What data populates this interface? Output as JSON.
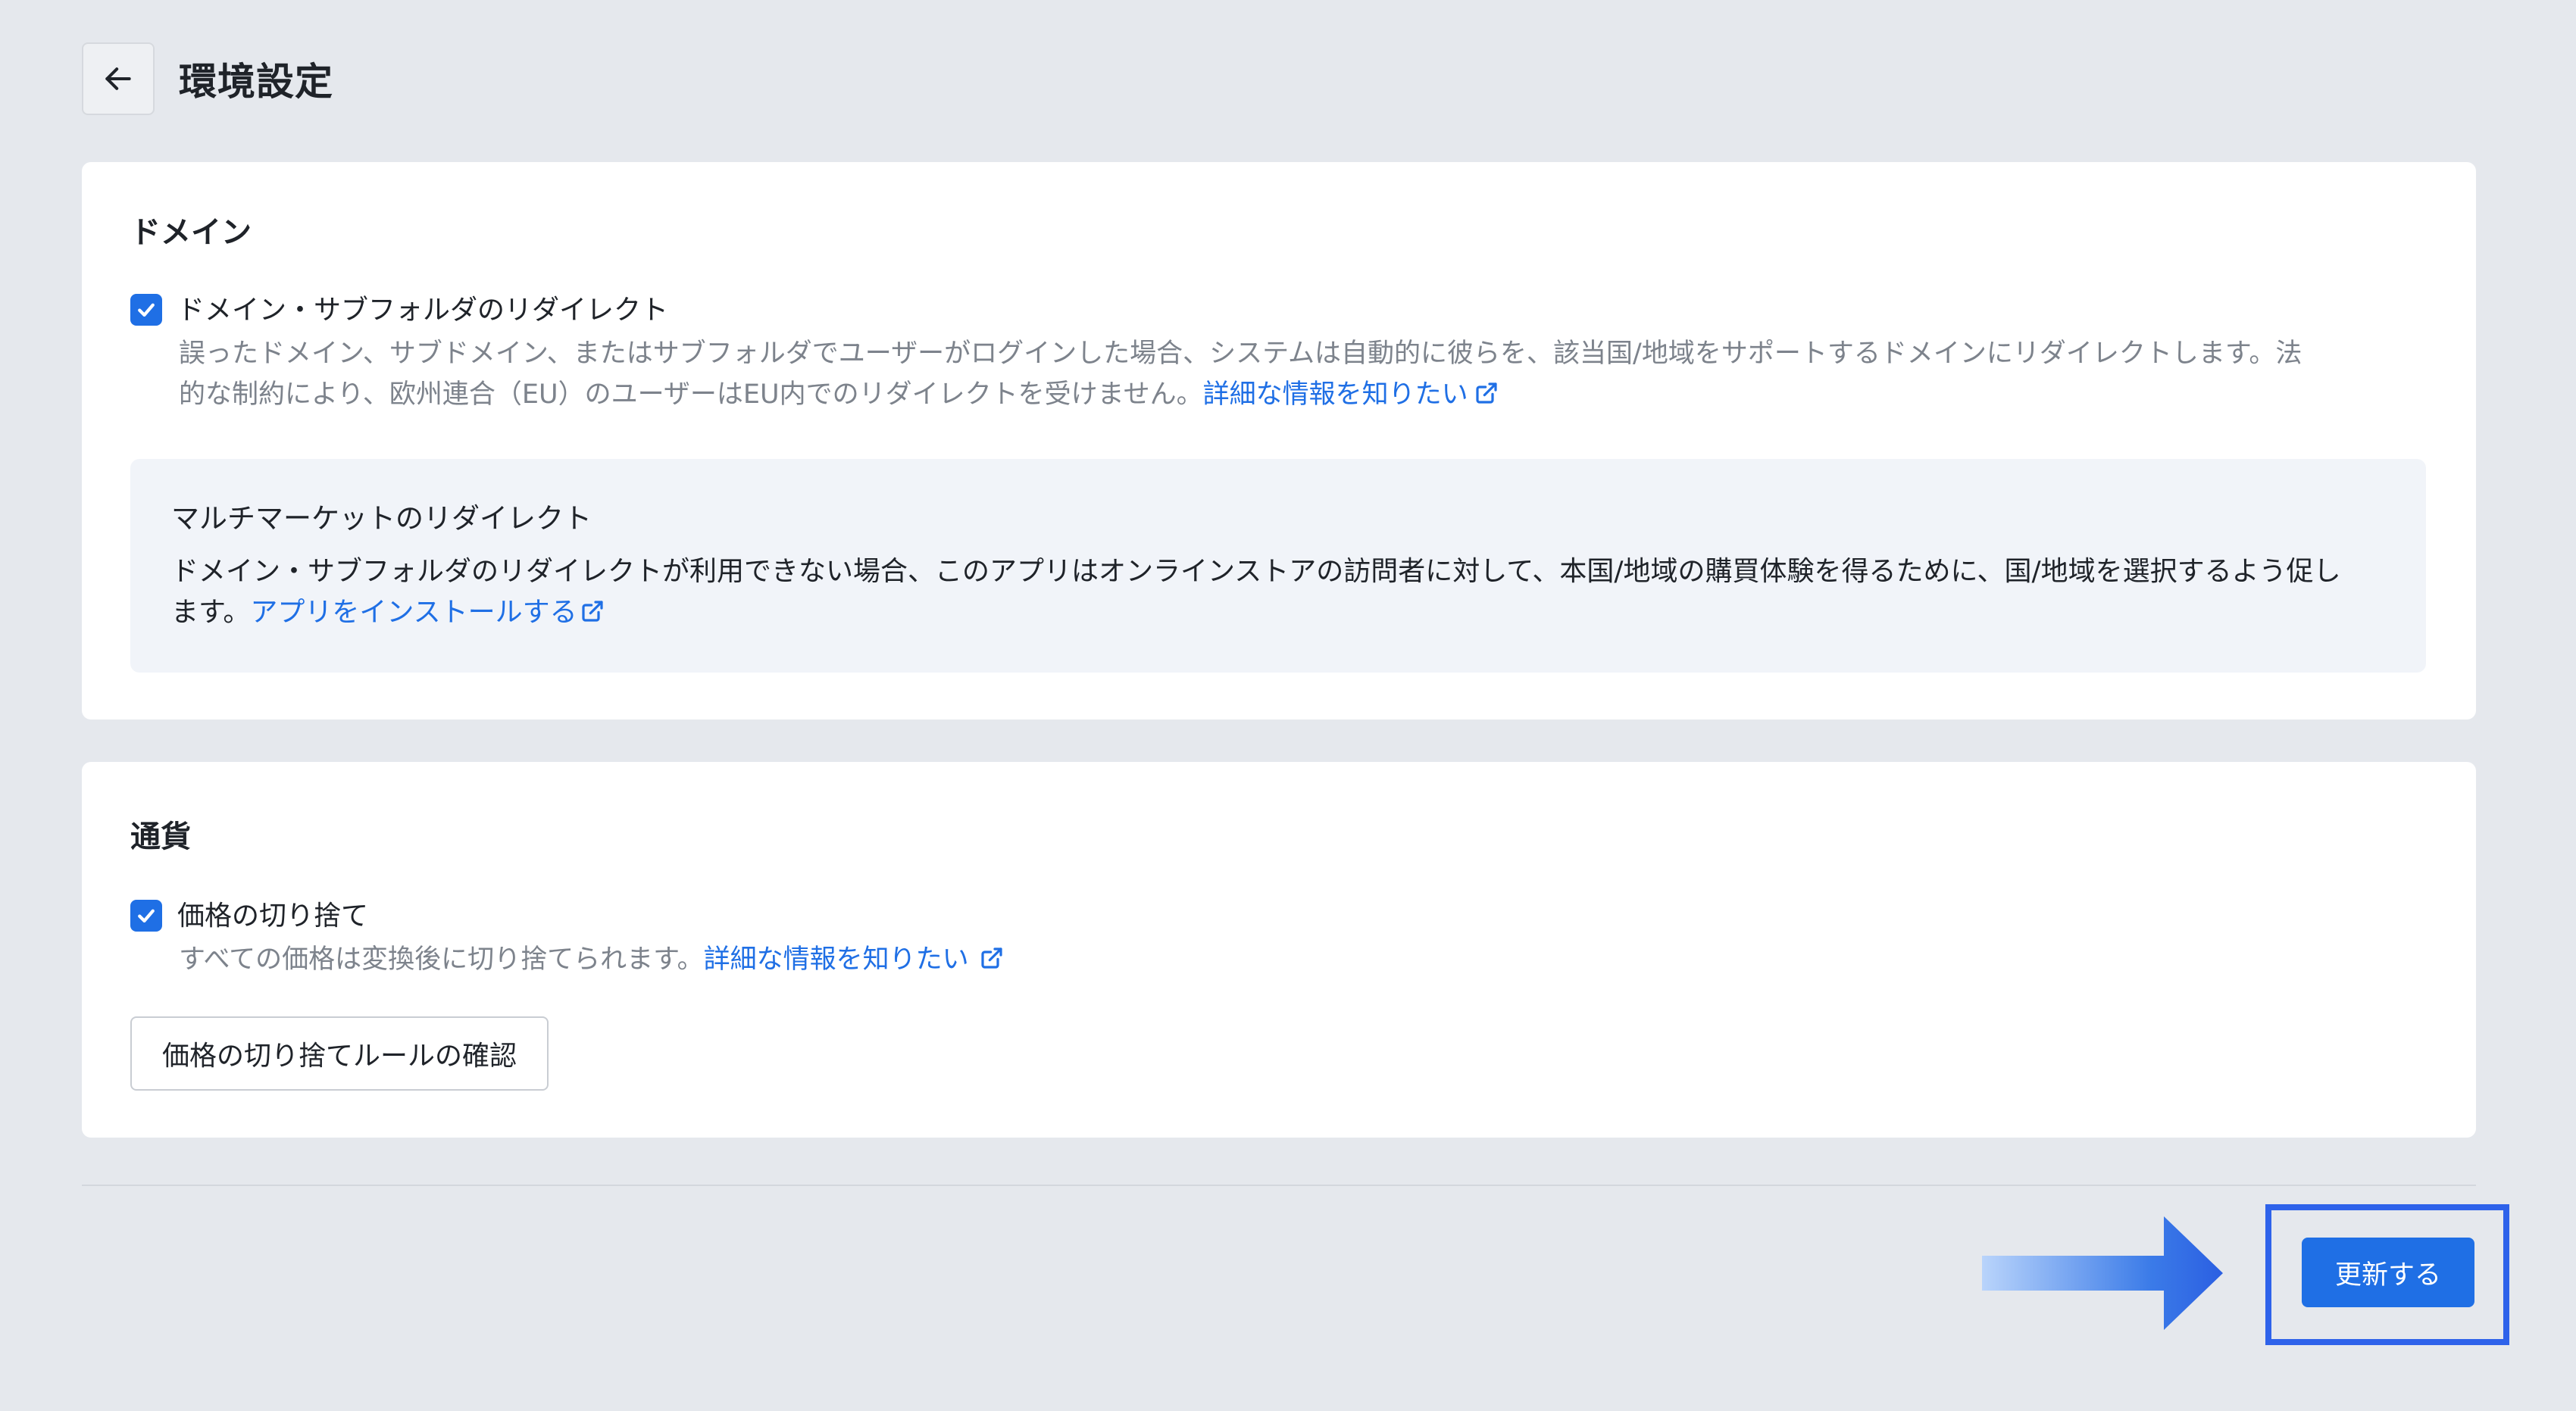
{
  "header": {
    "title": "環境設定",
    "back_icon": "arrow-left-icon"
  },
  "domain_section": {
    "title": "ドメイン",
    "redirect": {
      "checked": true,
      "label": "ドメイン・サブフォルダのリダイレクト",
      "description_line1": "誤ったドメイン、サブドメイン、またはサブフォルダでユーザーがログインした場合、システムは自動的に彼らを、該当国/地域をサポートするドメインにリダイレクトします。法",
      "description_line2": "的な制約により、欧州連合（EU）のユーザーはEU内でのリダイレクトを受けません。",
      "link": "詳細な情報を知りたい"
    },
    "multimarket": {
      "title": "マルチマーケットのリダイレクト",
      "text_line1": "ドメイン・サブフォルダのリダイレクトが利用できない場合、このアプリはオンラインストアの訪問者に対して、本国/地域の購買体験を得るために、国/地域を選択するよう促し",
      "text_line2": "ます。",
      "link": "アプリをインストールする"
    }
  },
  "currency_section": {
    "title": "通貨",
    "rounding": {
      "checked": true,
      "label": "価格の切り捨て",
      "description": "すべての価格は変換後に切り捨てられます。",
      "link": "詳細な情報を知りたい"
    },
    "rule_button": "価格の切り捨てルールの確認"
  },
  "footer": {
    "update_button": "更新する"
  },
  "colors": {
    "accent": "#1f6fe5",
    "highlight": "#2e62ea",
    "background": "#e5e8ed"
  }
}
